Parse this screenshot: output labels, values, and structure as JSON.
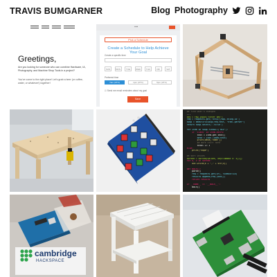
{
  "header": {
    "site_title": "TRAVIS BUMGARNER",
    "nav": [
      {
        "label": "Blog"
      },
      {
        "label": "Photography"
      }
    ],
    "social_icons": [
      "twitter-icon",
      "instagram-icon",
      "linkedin-icon"
    ]
  },
  "tiles": {
    "greetings": {
      "mini_nav": [
        "HOME",
        "ABOUT",
        "CONTACT",
        "PORTFOLIO"
      ],
      "heading": "Greetings,",
      "blurb": "Are you looking for someone who can combine Hardware, IA, Photography, and Machine Shop Tools in a project?",
      "blurb2": "You've come to the right place! Let's grab a beer (or coffee, water, or whatever!) together!"
    },
    "schedule": {
      "select_label": "Pick a Schedule",
      "heading": "Create a Schedule to Help Achieve Your Goal",
      "label_days": "Create a specific time",
      "days": [
        "SUN",
        "MON",
        "TUE",
        "WED",
        "THU",
        "FRI",
        "SAT"
      ],
      "label_times": "Preferred time",
      "times": [
        "7am (UTC)",
        "1pm (UTC)",
        "5pm (UTC)"
      ],
      "checkbox_label": "Send me email reminders about my goal",
      "save_label": "Save"
    },
    "brand": {
      "word": "cambridge",
      "sub": "HACKSPACE"
    },
    "code_lines": [
      "  ## find what's changed",
      "  ---",
      "  key = raw_input(\"Enter key\")",
      "  req = requests.get('http://api.thing.io')",
      "  soup = BeautifulSoup(req.text, \"html.parser\")",
      "  return soup.select('.title')",
      "",
      "  for item in soup.findAll('div'):",
      "      if 'class' in item.attrs:",
      "          text = item.get_text()",
      "          data = json.loads(text)",
      "          print(data['name'])",
      "          ## more stuff here",
      "          total += 1",
      "  else:",
      "      print(\"nope\")",
      "",
      "  ## sort values",
      "  sorted = sorted(values, key=lambda x: x[1])",
      "  for k, v in sorted:",
      "      out.write(k + \",\" + str(v))",
      "",
      "  def main():",
      "      parse()",
      "      req = requests.get(url, timeout=10)",
      "      results.append(req.json())",
      "      return results",
      "",
      "  if __name__ == '__main__':",
      "      main()"
    ]
  },
  "colors": {
    "accent_orange": "#e8532a",
    "accent_blue": "#2d8fd6"
  }
}
